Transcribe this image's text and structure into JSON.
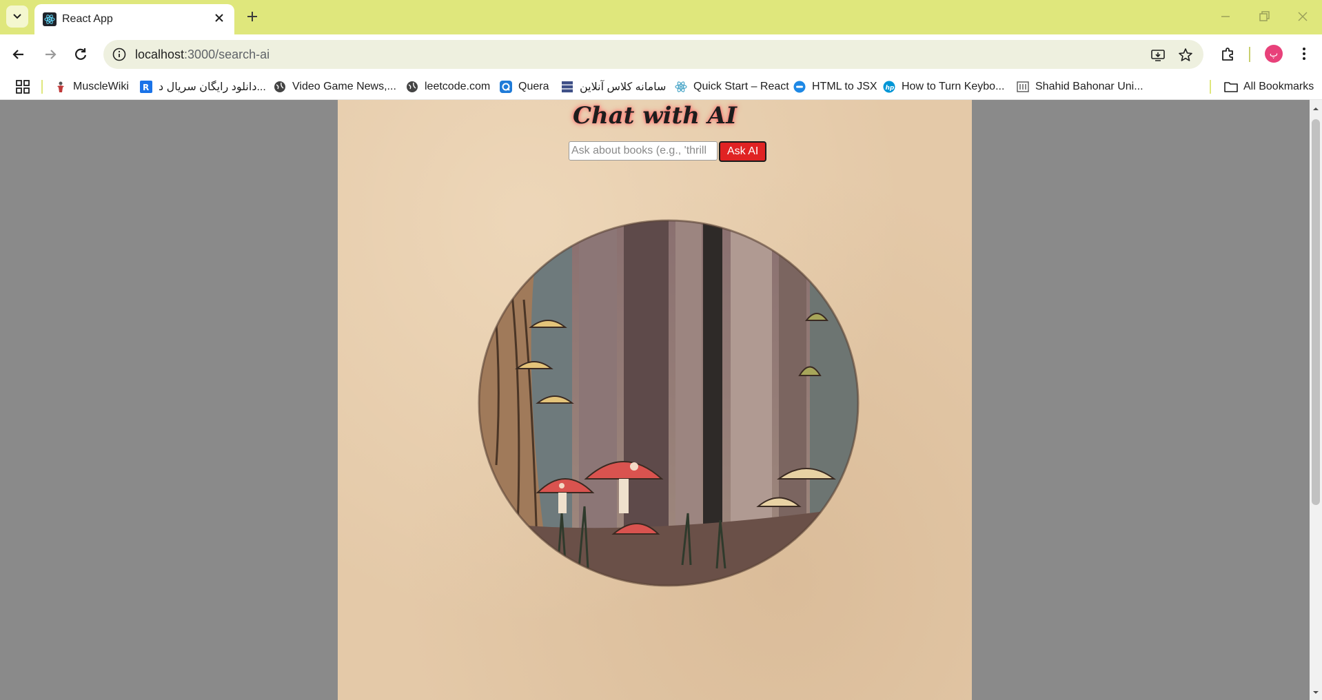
{
  "browser": {
    "tab": {
      "title": "React App"
    },
    "address": {
      "host": "localhost",
      "path": ":3000/search-ai"
    },
    "avatar_letter": "پ",
    "bookmarks": [
      {
        "label": "MuscleWiki",
        "icon": "musclewiki-icon"
      },
      {
        "label": "دانلود رایگان سریال د...",
        "icon": "r-logo-icon"
      },
      {
        "label": "Video Game News,...",
        "icon": "globe-icon"
      },
      {
        "label": "leetcode.com",
        "icon": "globe-icon"
      },
      {
        "label": "Quera",
        "icon": "quera-icon"
      },
      {
        "label": "سامانه کلاس آنلاین",
        "icon": "server-icon"
      },
      {
        "label": "Quick Start – React",
        "icon": "react-icon"
      },
      {
        "label": "HTML to JSX",
        "icon": "transform-icon"
      },
      {
        "label": "How to Turn Keybo...",
        "icon": "hp-icon"
      },
      {
        "label": "Shahid Bahonar Uni...",
        "icon": "university-icon"
      }
    ],
    "all_bookmarks": "All Bookmarks"
  },
  "page": {
    "title": "Chat with AI",
    "search": {
      "placeholder": "Ask about books (e.g., 'thrill",
      "value": ""
    },
    "ask_button": "Ask AI"
  },
  "colors": {
    "tabstrip": "#dfe77c",
    "page_background": "#8a8a8a",
    "paper": "#e4c9a8",
    "ask_button": "#e02323"
  }
}
